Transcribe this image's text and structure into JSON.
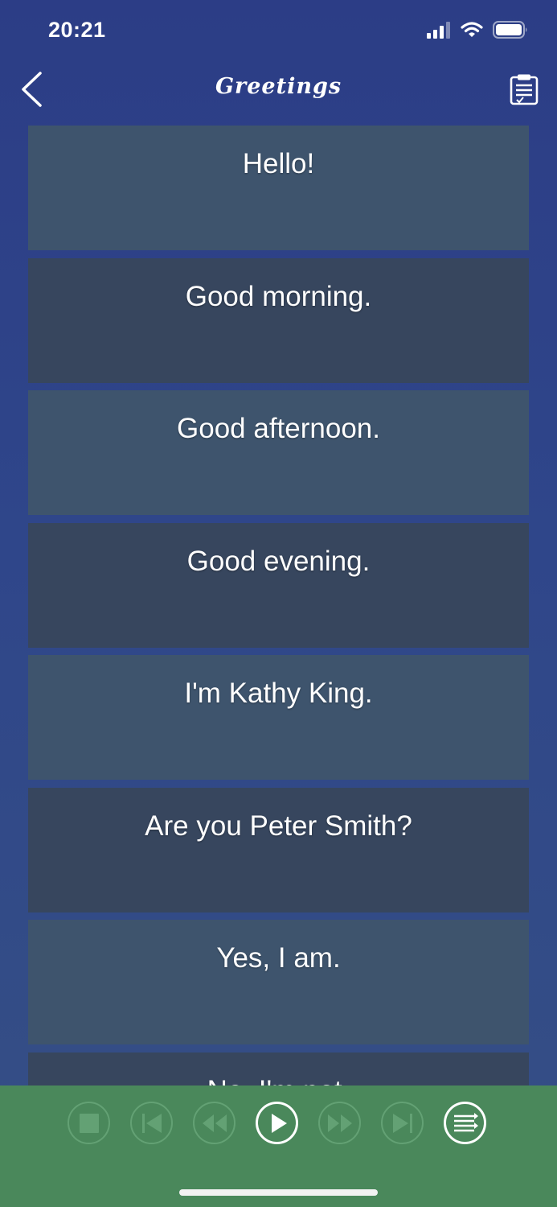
{
  "status_bar": {
    "time": "20:21",
    "icons": [
      "signal-icon",
      "wifi-icon",
      "battery-icon"
    ]
  },
  "nav": {
    "title": "Greetings",
    "back_icon": "chevron-left-icon",
    "right_icon": "clipboard-icon"
  },
  "phrases": [
    "Hello!",
    "Good morning.",
    "Good afternoon.",
    "Good evening.",
    "I'm Kathy King.",
    "Are you Peter Smith?",
    "Yes, I am.",
    "No, I'm not."
  ],
  "player": {
    "controls": [
      "stop-icon",
      "skip-back-icon",
      "rewind-icon",
      "play-icon",
      "fast-forward-icon",
      "skip-forward-icon",
      "playlist-icon"
    ],
    "active_control": "play-icon"
  },
  "colors": {
    "background": "#2c3d86",
    "row_light": "#3e546d",
    "row_dark": "#37465e",
    "player_bar": "#4a885b",
    "control_dim": "#63a174"
  }
}
